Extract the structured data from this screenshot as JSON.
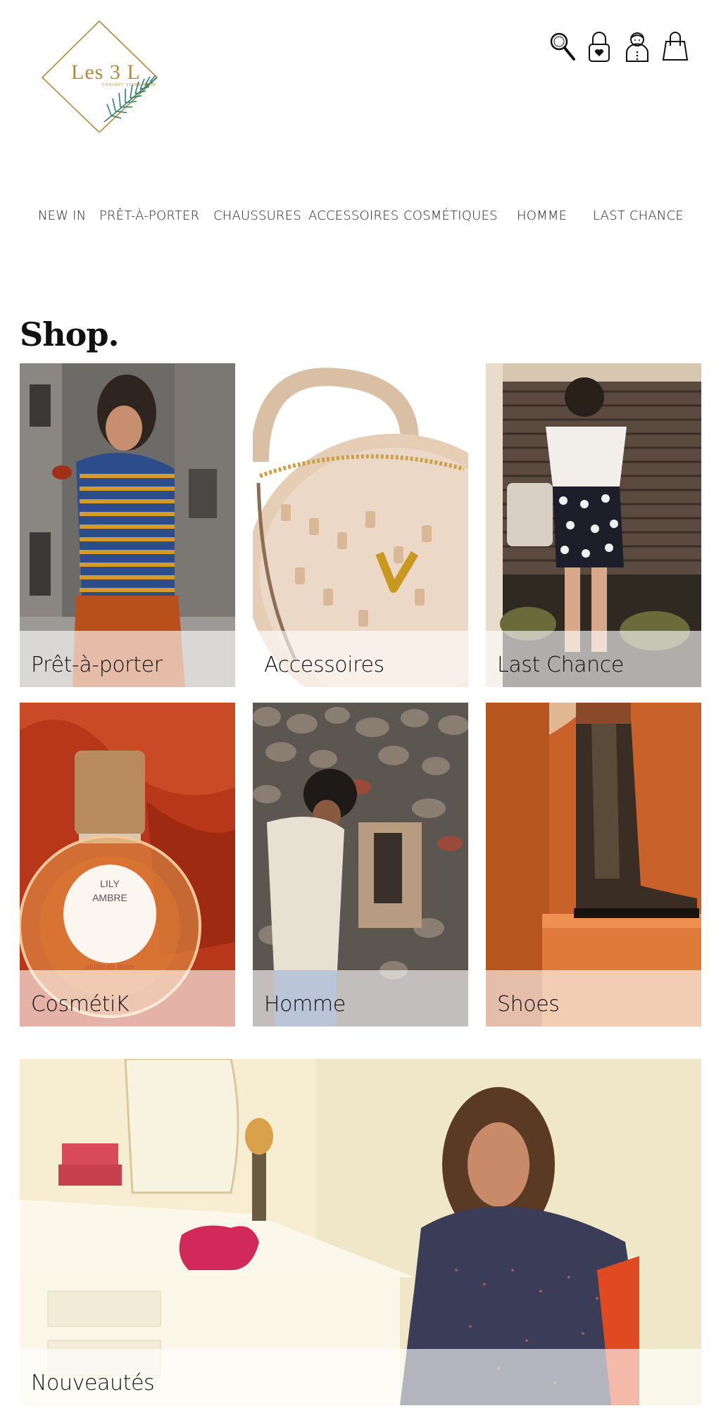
{
  "header": {
    "logo": {
      "text": "Les 3 L",
      "subtitle": "CONCEPT STORE MODE"
    },
    "icons": [
      "search-icon",
      "lock-icon",
      "account-icon",
      "cart-icon"
    ]
  },
  "nav": {
    "items": [
      {
        "label": "NEW IN"
      },
      {
        "label": "PRÊT-À-PORTER"
      },
      {
        "label": "CHAUSSURES"
      },
      {
        "label": "ACCESSOIRES"
      },
      {
        "label": "COSMÉTIQUES"
      },
      {
        "label": "HOMME"
      },
      {
        "label": "LAST CHANCE"
      }
    ]
  },
  "shop": {
    "title": "Shop.",
    "tiles": [
      {
        "label": "Prêt-à-porter"
      },
      {
        "label": "Accessoires"
      },
      {
        "label": "Last Chance"
      },
      {
        "label": "CosmétiK"
      },
      {
        "label": "Homme"
      },
      {
        "label": "Shoes"
      },
      {
        "label": "Nouveautés"
      }
    ]
  },
  "perfume": {
    "name_line1": "LILY",
    "name_line2": "AMBRE",
    "brand": "année de mars"
  },
  "colors": {
    "accent_gold": "#b08a3e",
    "leaf_green": "#2f7d6a",
    "text": "#222222",
    "overlay": "rgba(255,255,255,0.62)"
  }
}
